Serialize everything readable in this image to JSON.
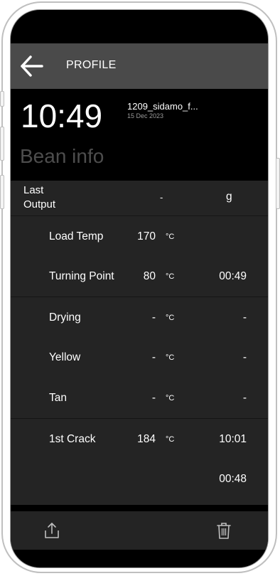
{
  "header": {
    "title": "PROFILE",
    "back_icon": "arrow-left-icon"
  },
  "info": {
    "time": "10:49",
    "file_name": "1209_sidamo_f...",
    "date": "15 Dec 2023",
    "section_title": "Bean info"
  },
  "last_output": {
    "label_line1": "Last",
    "label_line2": "Output",
    "value": "-",
    "unit": "g"
  },
  "rows": [
    {
      "label": "Load Temp",
      "value": "170",
      "unit": "°C",
      "time": ""
    },
    {
      "label": "Turning Point",
      "value": "80",
      "unit": "°C",
      "time": "00:49"
    },
    {
      "label": "Drying",
      "value": "-",
      "unit": "°C",
      "time": "-"
    },
    {
      "label": "Yellow",
      "value": "-",
      "unit": "°C",
      "time": "-"
    },
    {
      "label": "Tan",
      "value": "-",
      "unit": "°C",
      "time": "-"
    },
    {
      "label": "1st Crack",
      "value": "184",
      "unit": "°C",
      "time": "10:01"
    },
    {
      "label": "",
      "value": "",
      "unit": "",
      "time": "00:48"
    }
  ],
  "footer": {
    "share_icon": "share-icon",
    "delete_icon": "trash-icon"
  }
}
